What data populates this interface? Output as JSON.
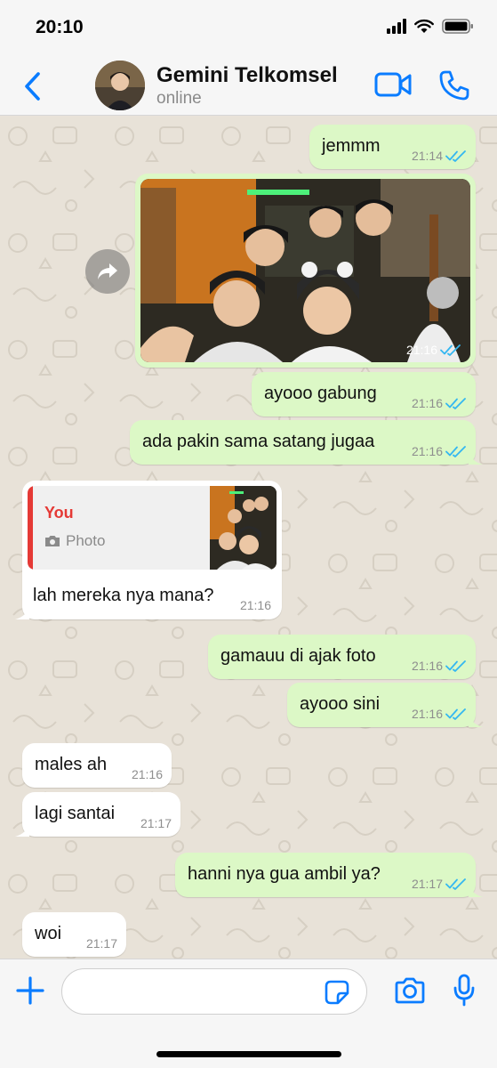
{
  "status_bar": {
    "time": "20:10"
  },
  "header": {
    "contact_name": "Gemini Telkomsel",
    "status": "online"
  },
  "messages": [
    {
      "direction": "out",
      "text": "jemmm",
      "time": "21:14",
      "read": true
    },
    {
      "direction": "out",
      "type": "photo",
      "time": "21:16",
      "read": true
    },
    {
      "direction": "out",
      "text": "ayooo gabung",
      "time": "21:16",
      "read": true
    },
    {
      "direction": "out",
      "text": "ada pakin sama satang jugaa",
      "time": "21:16",
      "read": true
    },
    {
      "direction": "in",
      "text": "lah mereka nya mana?",
      "time": "21:16",
      "reply_to": {
        "author": "You",
        "type_label": "Photo"
      }
    },
    {
      "direction": "out",
      "text": "gamauu di ajak foto",
      "time": "21:16",
      "read": true
    },
    {
      "direction": "out",
      "text": "ayooo sini",
      "time": "21:16",
      "read": true
    },
    {
      "direction": "in",
      "text": "males ah",
      "time": "21:16"
    },
    {
      "direction": "in",
      "text": "lagi santai",
      "time": "21:17"
    },
    {
      "direction": "out",
      "text": "hanni nya gua ambil ya?",
      "time": "21:17",
      "read": true
    },
    {
      "direction": "in",
      "text": "woi",
      "time": "21:17"
    }
  ],
  "composer": {
    "value": "",
    "placeholder": ""
  },
  "colors": {
    "accent": "#0a7cff",
    "outgoing_bubble": "#dcf8c6",
    "incoming_bubble": "#ffffff",
    "read_ticks": "#34b7f1",
    "reply_author": "#e53935"
  },
  "icons": [
    "back-chevron-icon",
    "video-call-icon",
    "phone-icon",
    "forward-icon",
    "read-ticks-icon",
    "camera-icon",
    "plus-icon",
    "sticker-icon",
    "microphone-icon"
  ]
}
